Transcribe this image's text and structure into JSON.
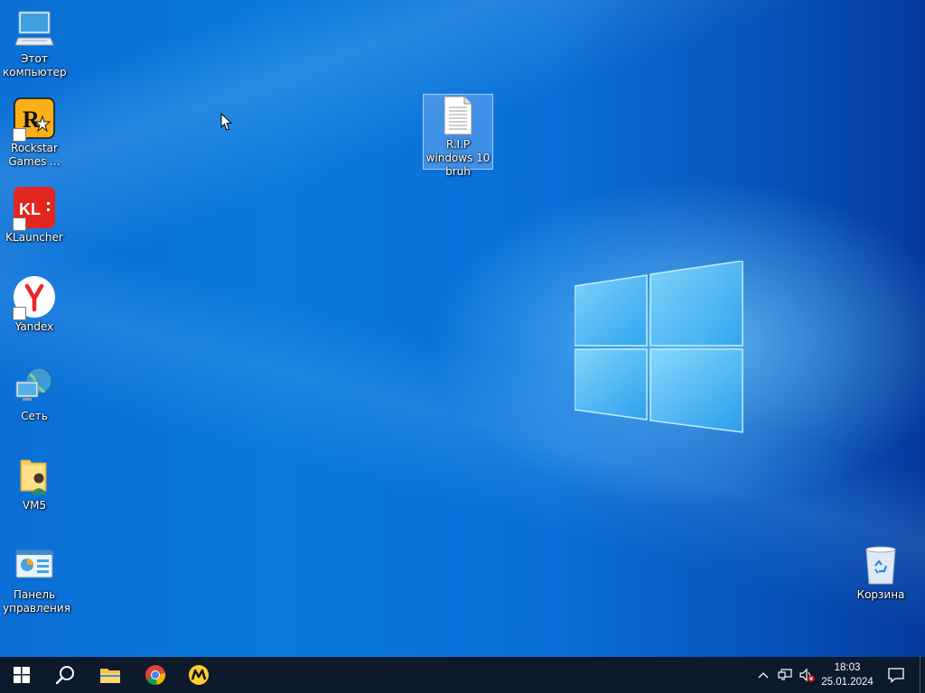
{
  "desktop": {
    "icons": [
      {
        "label": "Этот компьютер",
        "icon": "computer-icon"
      },
      {
        "label": "Rockstar Games ...",
        "icon": "rockstar-icon"
      },
      {
        "label": "KLauncher",
        "icon": "klauncher-icon"
      },
      {
        "label": "Yandex",
        "icon": "yandex-icon"
      },
      {
        "label": "Сеть",
        "icon": "network-icon"
      },
      {
        "label": "VM5",
        "icon": "user-folder-icon"
      },
      {
        "label": "Панель управления",
        "icon": "control-panel-icon"
      },
      {
        "label": "R.I.P windows 10 bruh",
        "icon": "text-document-icon"
      },
      {
        "label": "Корзина",
        "icon": "recycle-bin-icon"
      }
    ],
    "logo_text": "KL"
  },
  "taskbar": {
    "pinned": [
      {
        "name": "start",
        "icon": "windows-start-icon"
      },
      {
        "name": "search",
        "icon": "search-icon"
      },
      {
        "name": "file-explorer",
        "icon": "folder-icon"
      },
      {
        "name": "chrome",
        "icon": "chrome-icon"
      },
      {
        "name": "yandex-market",
        "icon": "yandex-market-icon"
      }
    ],
    "clock": {
      "time": "18:03",
      "date": "25.01.2024"
    }
  },
  "colors": {
    "accent": "#0a78dc",
    "taskbar": "#0d1a2b"
  }
}
